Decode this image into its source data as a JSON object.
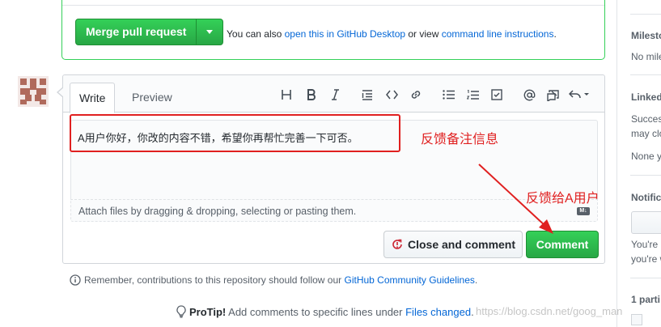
{
  "merge": {
    "button_label": "Merge pull request",
    "text_prefix": "You can also ",
    "link_desktop": "open this in GitHub Desktop",
    "text_mid": " or view ",
    "link_cli": "command line instructions",
    "text_suffix": "."
  },
  "editor": {
    "tabs": [
      {
        "label": "Write"
      },
      {
        "label": "Preview"
      }
    ],
    "toolbar_icons": [
      "header-icon",
      "bold-icon",
      "italic-icon",
      "quote-icon",
      "code-icon",
      "link-icon",
      "unordered-list-icon",
      "ordered-list-icon",
      "task-list-icon",
      "mention-icon",
      "reference-icon",
      "reply-icon"
    ],
    "textarea_value": "A用户你好，你改的内容不错，希望你再帮忙完善一下可否。",
    "attach_text": "Attach files by dragging & dropping, selecting or pasting them.",
    "markdown_badge": "M↓"
  },
  "buttons": {
    "close_and_comment": "Close and comment",
    "comment": "Comment"
  },
  "annotations": {
    "note_feedback": "反馈备注信息",
    "note_to_user": "反馈给A用户",
    "color": "#e02020"
  },
  "footer": {
    "reminder_text": "Remember, contributions to this repository should follow our ",
    "reminder_link": "GitHub Community Guidelines",
    "reminder_suffix": ".",
    "protip_label": "ProTip!",
    "protip_text": " Add comments to specific lines under ",
    "protip_link": "Files changed",
    "protip_suffix": ".",
    "watermark": "https://blog.csdn.net/goog_man"
  },
  "sidebar": {
    "milestone_head": "Milesto",
    "milestone_value": "No mile",
    "linked_head": "Linked",
    "linked_text_1": "Success",
    "linked_text_2": "may clo",
    "linked_value": "None y",
    "notif_head": "Notific",
    "notif_text_1": "You're",
    "notif_text_2": "you're w",
    "participants_head": "1 parti"
  },
  "colors": {
    "primary_green": "#28a745",
    "link_blue": "#0366d6",
    "annotation_red": "#e02020"
  }
}
